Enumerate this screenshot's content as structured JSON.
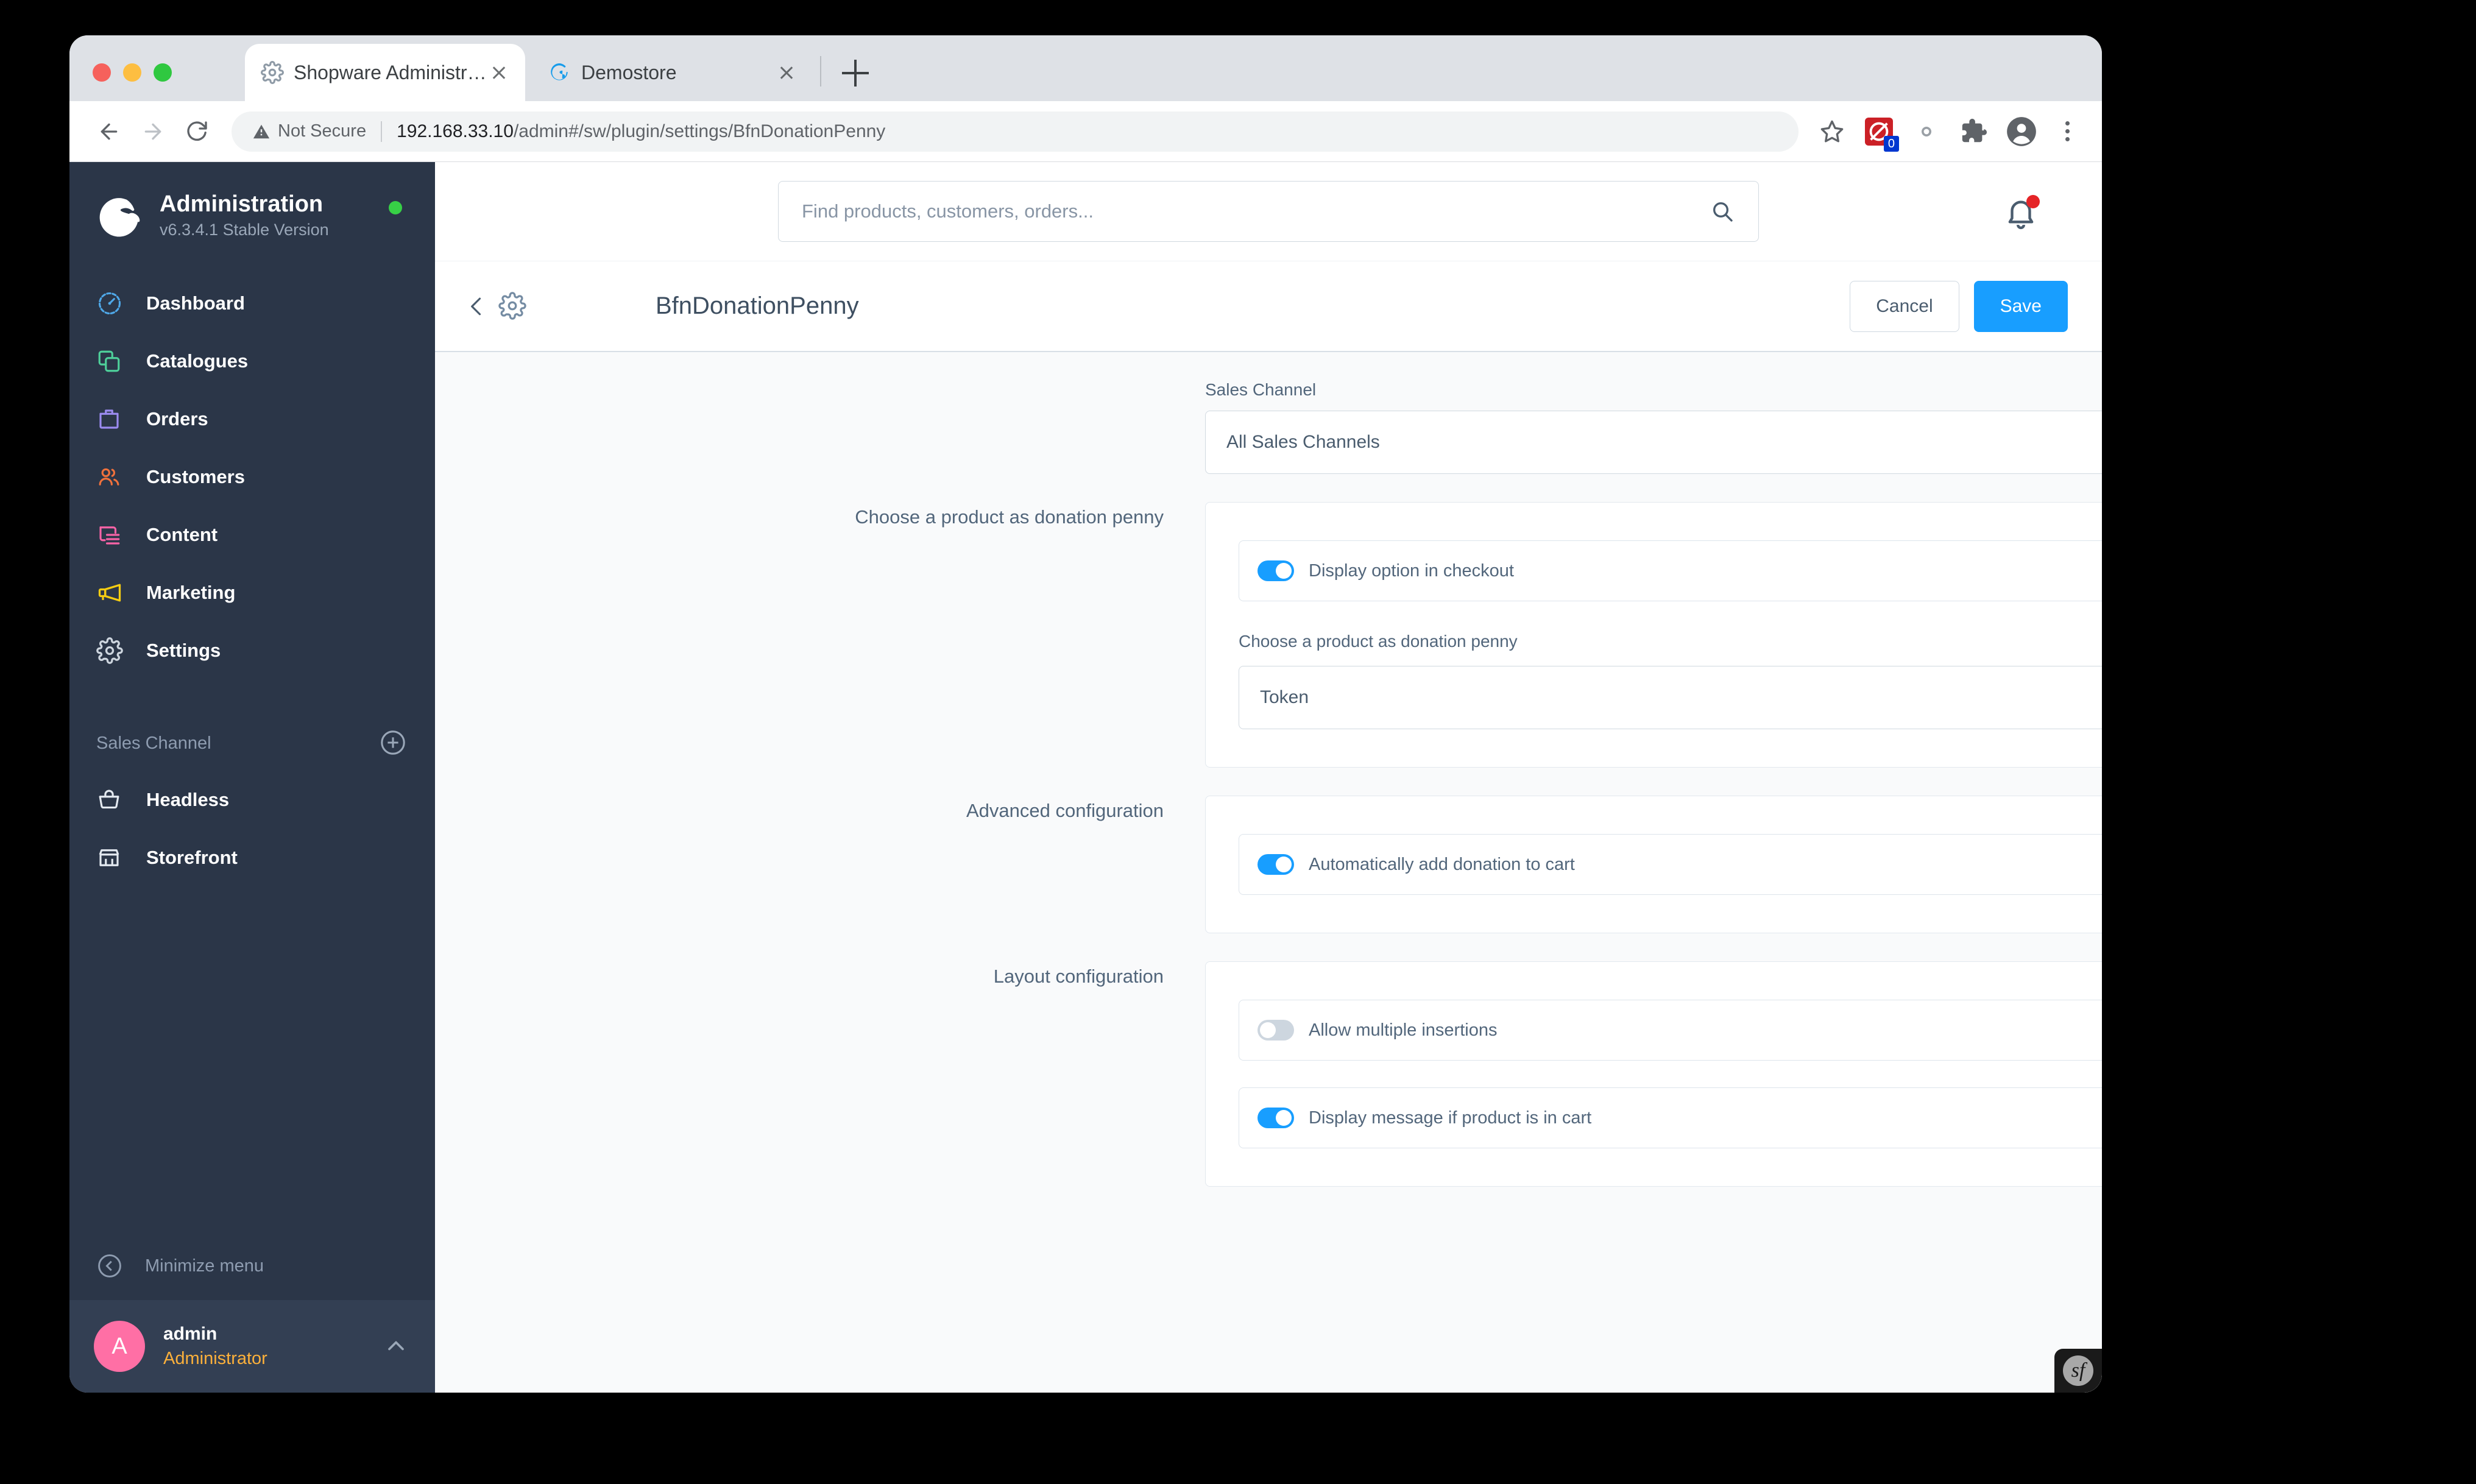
{
  "browser": {
    "tabs": [
      {
        "title": "Shopware Administration",
        "favicon": "gear-icon",
        "active": true
      },
      {
        "title": "Demostore",
        "favicon": "shopware-logo-icon",
        "active": false
      }
    ],
    "new_tab_label": "+",
    "security_label": "Not Secure",
    "url_host": "192.168.33.10",
    "url_path": "/admin#/sw/plugin/settings/BfnDonationPenny",
    "extension_badge": "0"
  },
  "sidebar": {
    "brand": {
      "title": "Administration",
      "version": "v6.3.4.1 Stable Version",
      "status_color": "#37d046"
    },
    "nav_items": [
      {
        "label": "Dashboard",
        "icon": "speedometer-icon",
        "color": "#4fa8e8"
      },
      {
        "label": "Catalogues",
        "icon": "copy-icon",
        "color": "#4ecf9a"
      },
      {
        "label": "Orders",
        "icon": "bag-icon",
        "color": "#9b8bf0"
      },
      {
        "label": "Customers",
        "icon": "users-icon",
        "color": "#f0713c"
      },
      {
        "label": "Content",
        "icon": "content-icon",
        "color": "#f763a6"
      },
      {
        "label": "Marketing",
        "icon": "megaphone-icon",
        "color": "#f5cc12"
      },
      {
        "label": "Settings",
        "icon": "gear-icon",
        "color": "#cdd5de"
      }
    ],
    "sales_channel": {
      "section_title": "Sales Channel",
      "add_label": "+",
      "items": [
        {
          "label": "Headless",
          "icon": "basket-icon"
        },
        {
          "label": "Storefront",
          "icon": "store-icon"
        }
      ]
    },
    "minimize_label": "Minimize menu",
    "user": {
      "initial": "A",
      "name": "admin",
      "role": "Administrator",
      "avatar_color": "#ff6fa5"
    }
  },
  "header": {
    "search_placeholder": "Find products, customers, orders...",
    "search_value": "",
    "search_icon": "magnifier-icon",
    "bell_icon": "bell-icon",
    "has_notification": true
  },
  "page": {
    "title": "BfnDonationPenny",
    "back_icon": "chevron-left-icon",
    "gear_icon": "gear-icon",
    "cancel_label": "Cancel",
    "save_label": "Save",
    "accent_color": "#189eff"
  },
  "form": {
    "sales_channel_field": {
      "label": "Sales Channel",
      "value": "All Sales Channels"
    },
    "sections": [
      {
        "label": "Choose a product as donation penny",
        "toggles": [
          {
            "label": "Display option in checkout",
            "state": "on",
            "help": "?"
          }
        ],
        "select_field": {
          "label": "Choose a product as donation penny",
          "value": "Token",
          "help": "?"
        }
      },
      {
        "label": "Advanced configuration",
        "toggles": [
          {
            "label": "Automatically add donation to cart",
            "state": "on",
            "help": "?"
          }
        ]
      },
      {
        "label": "Layout configuration",
        "toggles": [
          {
            "label": "Allow multiple insertions",
            "state": "off",
            "help": "?"
          },
          {
            "label": "Display message if product is in cart",
            "state": "on",
            "help": "?"
          }
        ]
      }
    ]
  },
  "footer": {
    "symfony_badge": "sf"
  }
}
